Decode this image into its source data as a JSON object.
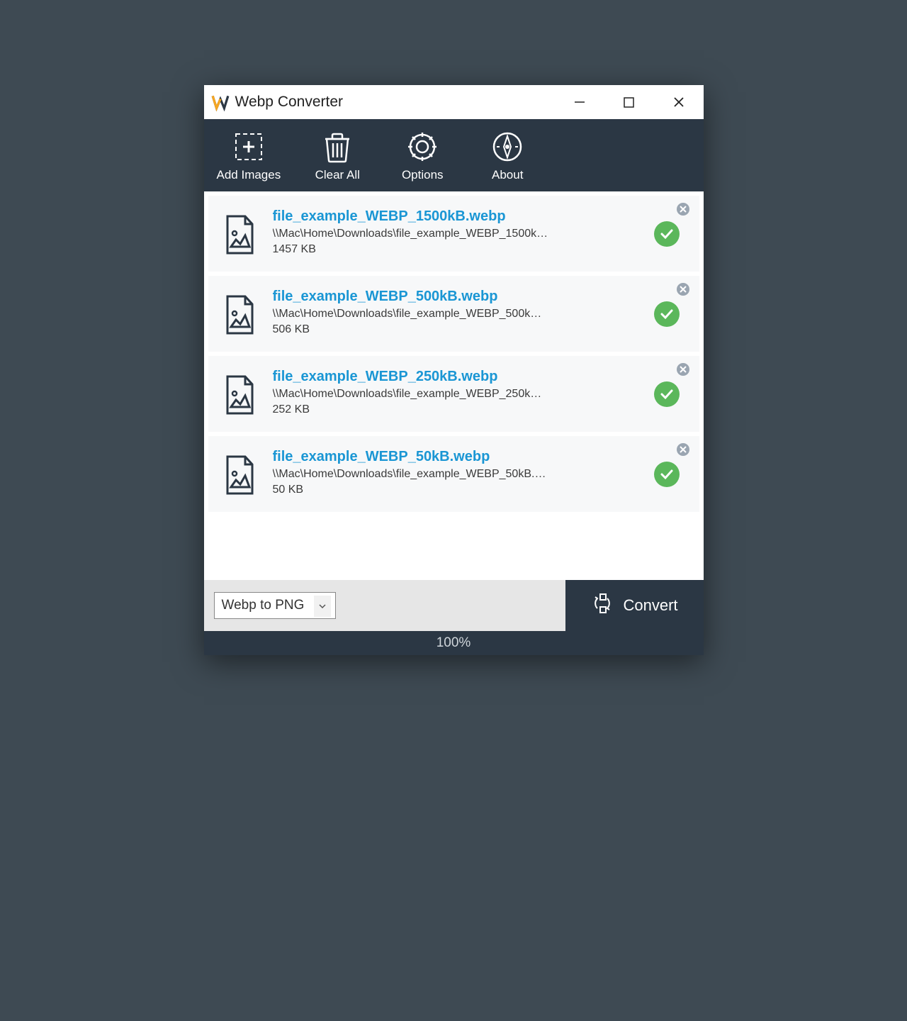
{
  "window": {
    "title": "Webp Converter"
  },
  "toolbar": {
    "add_images": "Add Images",
    "clear_all": "Clear All",
    "options": "Options",
    "about": "About"
  },
  "files": [
    {
      "name": "file_example_WEBP_1500kB.webp",
      "path": "\\\\Mac\\Home\\Downloads\\file_example_WEBP_1500kB....",
      "size": "1457 KB"
    },
    {
      "name": "file_example_WEBP_500kB.webp",
      "path": "\\\\Mac\\Home\\Downloads\\file_example_WEBP_500kB....",
      "size": "506 KB"
    },
    {
      "name": "file_example_WEBP_250kB.webp",
      "path": "\\\\Mac\\Home\\Downloads\\file_example_WEBP_250kB....",
      "size": "252 KB"
    },
    {
      "name": "file_example_WEBP_50kB.webp",
      "path": "\\\\Mac\\Home\\Downloads\\file_example_WEBP_50kB.w...",
      "size": "50 KB"
    }
  ],
  "bottom": {
    "format_selected": "Webp to PNG",
    "convert_label": "Convert"
  },
  "progress": {
    "text": "100%"
  }
}
